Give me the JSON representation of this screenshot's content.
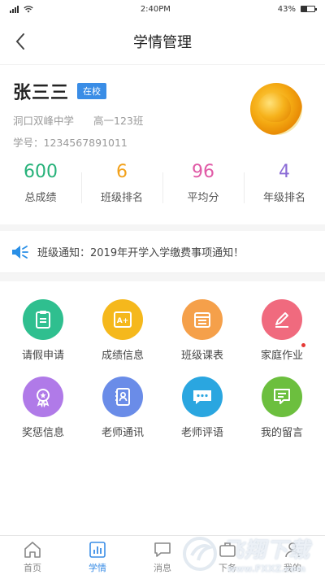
{
  "status_bar": {
    "time": "2:40PM",
    "battery": "43%",
    "battery_fraction": 0.43
  },
  "header": {
    "title": "学情管理"
  },
  "profile": {
    "name": "张三三",
    "status": "在校",
    "school": "洞口双峰中学",
    "class": "高一123班",
    "student_id": "学号：1234567891011"
  },
  "stats": [
    {
      "value": "600",
      "label": "总成绩",
      "color": "#27b27a"
    },
    {
      "value": "6",
      "label": "班级排名",
      "color": "#f2a11b"
    },
    {
      "value": "96",
      "label": "平均分",
      "color": "#e05aa6"
    },
    {
      "value": "4",
      "label": "年级排名",
      "color": "#8a6ad6"
    }
  ],
  "notice": {
    "text": "班级通知：2019年开学入学缴费事项通知！"
  },
  "features": [
    {
      "label": "请假申请",
      "color": "#2fbf8f",
      "icon": "leave-request-icon"
    },
    {
      "label": "成绩信息",
      "color": "#f5b81c",
      "icon": "grades-icon"
    },
    {
      "label": "班级课表",
      "color": "#f5a04a",
      "icon": "schedule-icon"
    },
    {
      "label": "家庭作业",
      "color": "#f06a7e",
      "icon": "homework-icon"
    },
    {
      "label": "奖惩信息",
      "color": "#b07ae8",
      "icon": "award-icon"
    },
    {
      "label": "老师通讯",
      "color": "#6a8ce8",
      "icon": "contacts-icon"
    },
    {
      "label": "老师评语",
      "color": "#2aa6e0",
      "icon": "comments-icon"
    },
    {
      "label": "我的留言",
      "color": "#6cbf3e",
      "icon": "message-icon"
    }
  ],
  "tabs": [
    {
      "label": "首页"
    },
    {
      "label": "学情"
    },
    {
      "label": "消息"
    },
    {
      "label": "下务"
    },
    {
      "label": "我的"
    }
  ],
  "watermark": {
    "brand": "飞翔下载",
    "url": "www.FXXZ.com"
  }
}
